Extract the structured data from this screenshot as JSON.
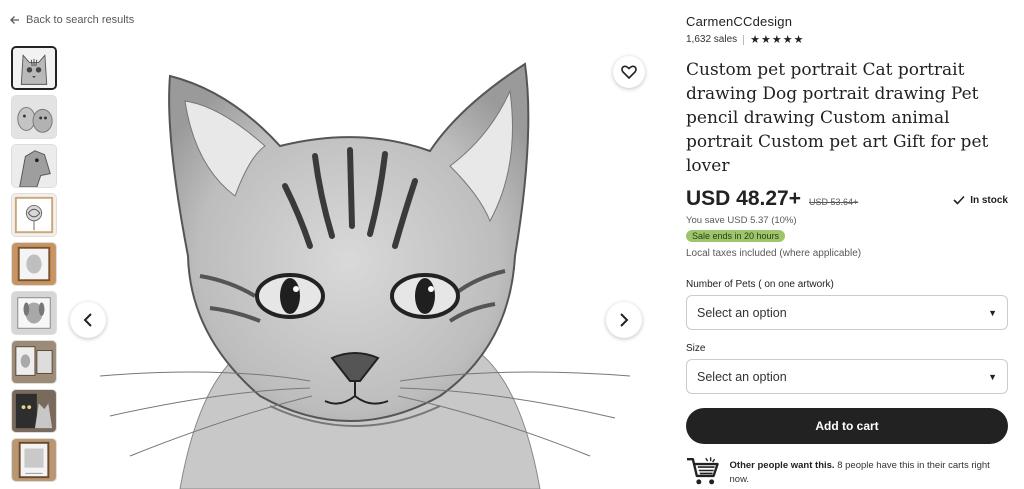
{
  "nav": {
    "back_label": "Back to search results"
  },
  "gallery": {
    "thumbnails": [
      {
        "label": "cat-pencil-portrait",
        "active": true
      },
      {
        "label": "two-pets-drawing",
        "active": false
      },
      {
        "label": "horse-drawing",
        "active": false
      },
      {
        "label": "rose-drawing",
        "active": false
      },
      {
        "label": "framed-portrait",
        "active": false
      },
      {
        "label": "dog-drawing",
        "active": false
      },
      {
        "label": "portrait-on-shelf",
        "active": false
      },
      {
        "label": "cat-photo-reference",
        "active": false
      },
      {
        "label": "framed-artwork",
        "active": false
      }
    ]
  },
  "shop": {
    "name": "CarmenCCdesign",
    "sales": "1,632 sales",
    "stars": "★★★★★"
  },
  "product": {
    "title": "Custom pet portrait Cat portrait drawing Dog portrait drawing Pet pencil drawing Custom animal portrait Custom pet art Gift for pet lover",
    "price": "USD 48.27+",
    "original_price": "USD 53.64+",
    "stock": "In stock",
    "savings": "You save USD 5.37 (10%)",
    "sale_badge": "Sale ends in 20 hours",
    "tax_note": "Local taxes included (where applicable)"
  },
  "options": {
    "pets_label": "Number of Pets ( on one artwork)",
    "pets_value": "Select an option",
    "size_label": "Size",
    "size_value": "Select an option"
  },
  "cart": {
    "button_label": "Add to cart"
  },
  "social_proof": {
    "bold": "Other people want this.",
    "rest": " 8 people have this in their carts right now."
  },
  "colors": {
    "text": "#222222",
    "muted": "#595959",
    "sale_badge_bg": "#9ec46c",
    "cart_button_bg": "#222222"
  }
}
